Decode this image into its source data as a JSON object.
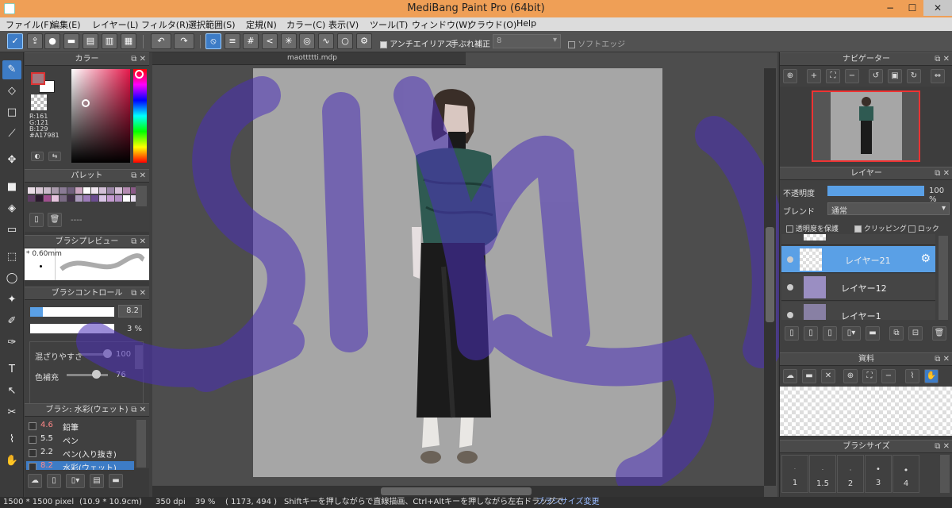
{
  "window": {
    "title": "MediBang Paint Pro (64bit)",
    "min": "−",
    "max": "☐",
    "close": "✕"
  },
  "menu": [
    "ファイル(F)",
    "編集(E)",
    "レイヤー(L)",
    "フィルタ(R)",
    "選択範囲(S)",
    "定規(N)",
    "カラー(C)",
    "表示(V)",
    "ツール(T)",
    "ウィンドウ(W)",
    "クラウド(O)",
    "Help"
  ],
  "toolbar": {
    "antialias": "アンチエイリアス",
    "stabilizer": "手ぶれ補正",
    "stabilizer_value": "8",
    "soft_edge": "ソフトエッジ"
  },
  "color_panel": {
    "title": "カラー",
    "r": "R:161",
    "g": "G:121",
    "b": "B:129",
    "hex": "#A17981"
  },
  "palette_panel": {
    "title": "パレット",
    "dash": "----",
    "swatches": [
      "#e9dde6",
      "#d9c8d6",
      "#c9b9c9",
      "#a99aab",
      "#8a7b95",
      "#6f5f7c",
      "#cba5c0",
      "#fff",
      "#f0e6f0",
      "#d3c0d8",
      "#9a86a6",
      "#d7c1d9",
      "#b38ab0",
      "#8b5a88",
      "#5d3d63",
      "#2b1a2e",
      "#a0508f",
      "#e6c4de",
      "#7a6a84",
      "#403047",
      "#ab9bbd",
      "#9d7cb9",
      "#6b4d90",
      "#d9c4e6",
      "#c49bd0",
      "#b28fc3",
      "#ffffff",
      "#e8dff0"
    ]
  },
  "brush_preview": {
    "title": "ブラシプレビュー",
    "size": "* 0.60mm"
  },
  "brush_control": {
    "title": "ブラシコントロール",
    "size_value": "8.2",
    "opacity_value": "3 %",
    "mix_label": "混ざりやすさ",
    "mix_value": "100",
    "color_label": "色補充",
    "color_value": "76"
  },
  "brush_list": {
    "title": "ブラシ: 水彩(ウェット)",
    "items": [
      {
        "v": "4.6",
        "n": "鉛筆"
      },
      {
        "v": "5.5",
        "n": "ペン"
      },
      {
        "v": "2.2",
        "n": "ペン(入り抜き)"
      },
      {
        "v": "8.2",
        "n": "水彩(ウェット)"
      }
    ]
  },
  "document": {
    "tab": "maottttti.mdp"
  },
  "navigator": {
    "title": "ナビゲーター"
  },
  "layer_panel": {
    "title": "レイヤー",
    "opacity_label": "不透明度",
    "opacity_value": "100 %",
    "blend_label": "ブレンド",
    "blend_value": "通常",
    "protect": "透明度を保護",
    "clipping": "クリッピング",
    "lock": "ロック",
    "layers": [
      "レイヤー21",
      "レイヤー12",
      "レイヤー1"
    ]
  },
  "material_panel": {
    "title": "資料"
  },
  "brush_size_panel": {
    "title": "ブラシサイズ",
    "sizes": [
      "1",
      "1.5",
      "2",
      "3",
      "4"
    ]
  },
  "status": {
    "dimensions": "1500 * 1500 pixel",
    "cm": "(10.9 * 10.9cm)",
    "dpi": "350 dpi",
    "zoom": "39 %",
    "coords": "( 1173, 494 )",
    "hint": "Shiftキーを押しながらで直線描画、Ctrl+Altキーを押しながら左右ドラッグで",
    "hint_link": "ブラシサイズ変更"
  },
  "colors": {
    "accent": "#3d7cc6",
    "titlebar": "#ef9f56",
    "canvas_bg": "#a6a6a6",
    "overlay": "#5b3fc4"
  }
}
